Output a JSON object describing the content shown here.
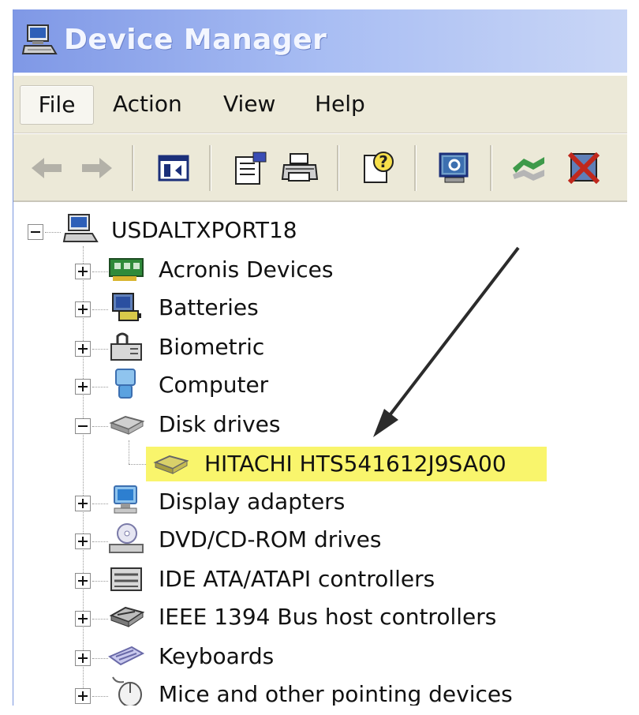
{
  "window": {
    "title": "Device Manager"
  },
  "menu": {
    "file": "File",
    "action": "Action",
    "view": "View",
    "help": "Help"
  },
  "tree": {
    "root": "USDALTXPORT18",
    "items": [
      {
        "label": "Acronis Devices",
        "icon": "acronis-card-icon",
        "state": "collapsed"
      },
      {
        "label": "Batteries",
        "icon": "battery-icon",
        "state": "collapsed"
      },
      {
        "label": "Biometric",
        "icon": "biometric-icon",
        "state": "collapsed"
      },
      {
        "label": "Computer",
        "icon": "computer-icon",
        "state": "collapsed"
      },
      {
        "label": "Disk drives",
        "icon": "disk-drive-icon",
        "state": "expanded",
        "children": [
          "HITACHI HTS541612J9SA00"
        ]
      },
      {
        "label": "Display adapters",
        "icon": "display-adapter-icon",
        "state": "collapsed"
      },
      {
        "label": "DVD/CD-ROM drives",
        "icon": "dvd-drive-icon",
        "state": "collapsed"
      },
      {
        "label": "IDE ATA/ATAPI controllers",
        "icon": "ide-controller-icon",
        "state": "collapsed"
      },
      {
        "label": "IEEE 1394 Bus host controllers",
        "icon": "ieee1394-icon",
        "state": "collapsed"
      },
      {
        "label": "Keyboards",
        "icon": "keyboard-icon",
        "state": "collapsed"
      },
      {
        "label": "Mice and other pointing devices",
        "icon": "mouse-icon",
        "state": "collapsed"
      }
    ]
  },
  "colors": {
    "title_gradient_start": "#7f98e6",
    "chrome": "#ece9d8",
    "highlight": "#f9f56c"
  }
}
